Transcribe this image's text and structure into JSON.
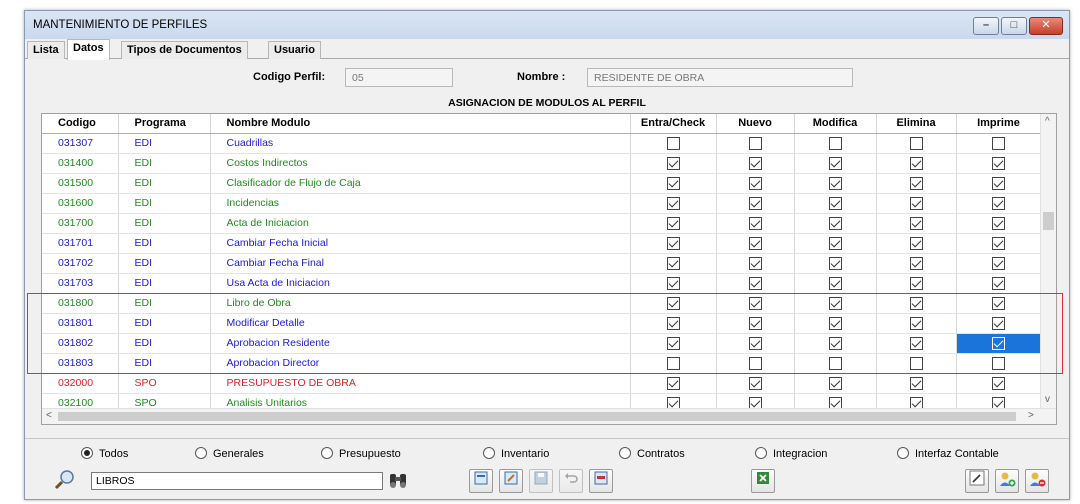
{
  "window": {
    "title": "MANTENIMIENTO DE PERFILES"
  },
  "tabs": [
    "Lista",
    "Datos",
    "Tipos de Documentos",
    "Usuario"
  ],
  "form": {
    "codigo_label": "Codigo Perfil:",
    "codigo_value": "05",
    "nombre_label": "Nombre :",
    "nombre_value": "RESIDENTE DE OBRA"
  },
  "grid": {
    "caption": "ASIGNACION DE MODULOS AL PERFIL",
    "columns": [
      "Codigo",
      "Programa",
      "Nombre Modulo",
      "Entra/Check",
      "Nuevo",
      "Modifica",
      "Elimina",
      "Imprime"
    ],
    "rows": [
      {
        "codigo": "031307",
        "programa": "EDI",
        "nombre": "Cuadrillas",
        "color": "#1a1ad0",
        "checks": [
          false,
          false,
          false,
          false,
          false
        ]
      },
      {
        "codigo": "031400",
        "programa": "EDI",
        "nombre": "Costos Indirectos",
        "color": "#1e8a1e",
        "checks": [
          true,
          true,
          true,
          true,
          true
        ]
      },
      {
        "codigo": "031500",
        "programa": "EDI",
        "nombre": "Clasificador de Flujo de Caja",
        "color": "#1e8a1e",
        "checks": [
          true,
          true,
          true,
          true,
          true
        ]
      },
      {
        "codigo": "031600",
        "programa": "EDI",
        "nombre": "Incidencias",
        "color": "#1e8a1e",
        "checks": [
          true,
          true,
          true,
          true,
          true
        ]
      },
      {
        "codigo": "031700",
        "programa": "EDI",
        "nombre": "Acta de Iniciacion",
        "color": "#1e8a1e",
        "checks": [
          true,
          true,
          true,
          true,
          true
        ]
      },
      {
        "codigo": "031701",
        "programa": "EDI",
        "nombre": "Cambiar Fecha Inicial",
        "color": "#1a1ad0",
        "checks": [
          true,
          true,
          true,
          true,
          true
        ]
      },
      {
        "codigo": "031702",
        "programa": "EDI",
        "nombre": "Cambiar Fecha Final",
        "color": "#1a1ad0",
        "checks": [
          true,
          true,
          true,
          true,
          true
        ]
      },
      {
        "codigo": "031703",
        "programa": "EDI",
        "nombre": "Usa Acta de Iniciacion",
        "color": "#1a1ad0",
        "checks": [
          true,
          true,
          true,
          true,
          true
        ]
      },
      {
        "codigo": "031800",
        "programa": "EDI",
        "nombre": "Libro de Obra",
        "color": "#1e8a1e",
        "checks": [
          true,
          true,
          true,
          true,
          true
        ]
      },
      {
        "codigo": "031801",
        "programa": "EDI",
        "nombre": "Modificar Detalle",
        "color": "#1a1ad0",
        "checks": [
          true,
          true,
          true,
          true,
          true
        ]
      },
      {
        "codigo": "031802",
        "programa": "EDI",
        "nombre": "Aprobacion Residente",
        "color": "#1a1ad0",
        "checks": [
          true,
          true,
          true,
          true,
          true
        ],
        "selected_col": 4
      },
      {
        "codigo": "031803",
        "programa": "EDI",
        "nombre": "Aprobacion Director",
        "color": "#1a1ad0",
        "checks": [
          false,
          false,
          false,
          false,
          false
        ]
      },
      {
        "codigo": "032000",
        "programa": "SPO",
        "nombre": "PRESUPUESTO DE OBRA",
        "color": "#e02020",
        "checks": [
          true,
          true,
          true,
          true,
          true
        ]
      },
      {
        "codigo": "032100",
        "programa": "SPO",
        "nombre": "Analisis Unitarios",
        "color": "#1e8a1e",
        "checks": [
          true,
          true,
          true,
          true,
          true
        ]
      }
    ]
  },
  "filters": {
    "options": [
      "Todos",
      "Generales",
      "Presupuesto",
      "Inventario",
      "Contratos",
      "Integracion",
      "Interfaz Contable"
    ],
    "selected": "Todos"
  },
  "search": {
    "value": "LIBROS"
  },
  "icons": {
    "search": "magnifier-icon",
    "binoculars": "binoculars-icon",
    "new": "new-record-icon",
    "edit": "edit-record-icon",
    "save": "save-icon",
    "undo": "undo-icon",
    "delete": "delete-icon",
    "excel": "excel-export-icon",
    "pencil": "pencil-icon",
    "user_add": "user-add-icon",
    "user_remove": "user-remove-icon"
  }
}
